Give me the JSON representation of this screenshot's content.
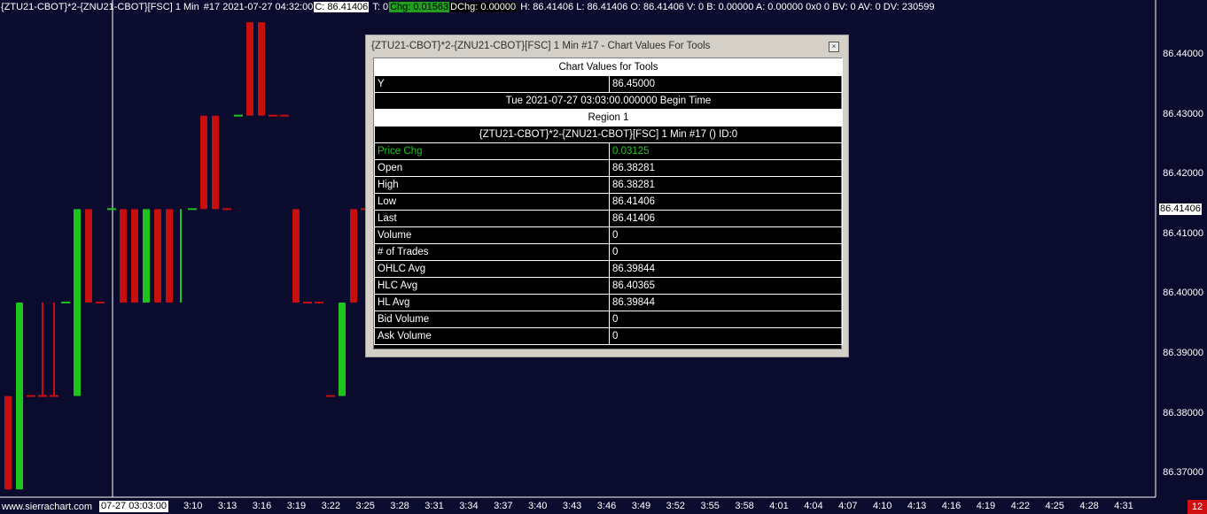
{
  "info_bar": {
    "symbol": "{ZTU21-CBOT}*2-{ZNU21-CBOT}[FSC]  1 Min",
    "bar_info": "#17 2021-07-27 04:32:00",
    "close": "C: 86.41406",
    "trades": "T: 0",
    "chg": "Chg: 0.01563",
    "dchg": "DChg: 0.00000",
    "rest": "H: 86.41406 L: 86.41406 O: 86.41406 V: 0 B: 0.00000 A: 0.00000 0x0 0 BV: 0 AV: 0 DV: 230599"
  },
  "tool_window": {
    "title": "{ZTU21-CBOT}*2-{ZNU21-CBOT}[FSC]  1 Min   #17 - Chart Values For Tools",
    "close_icon": "close-icon",
    "header": "Chart Values for Tools",
    "y_label": "Y",
    "y_value": "86.45000",
    "begin_time": "Tue 2021-07-27  03:03:00.000000 Begin Time",
    "region": "Region 1",
    "study_line": "{ZTU21-CBOT}*2-{ZNU21-CBOT}[FSC]  1 Min   #17 ()   ID:0",
    "rows": [
      {
        "name": "Price Chg",
        "value": "0.03125",
        "green": true
      },
      {
        "name": "Open",
        "value": "86.38281"
      },
      {
        "name": "High",
        "value": "86.38281"
      },
      {
        "name": "Low",
        "value": "86.41406"
      },
      {
        "name": "Last",
        "value": "86.41406"
      },
      {
        "name": "Volume",
        "value": "0"
      },
      {
        "name": "# of Trades",
        "value": "0"
      },
      {
        "name": "OHLC Avg",
        "value": "86.39844"
      },
      {
        "name": "HLC Avg",
        "value": "86.40365"
      },
      {
        "name": "HL Avg",
        "value": "86.39844"
      },
      {
        "name": "Bid Volume",
        "value": "0"
      },
      {
        "name": "Ask Volume",
        "value": "0"
      }
    ]
  },
  "price_axis": {
    "labels": [
      "86.44000",
      "86.43000",
      "86.42000",
      "86.41000",
      "86.40000",
      "86.39000",
      "86.38000",
      "86.37000"
    ],
    "last_price": "86.41406"
  },
  "time_axis": {
    "cursor_time": "07-27  03:03:00",
    "labels": [
      "3:10",
      "3:13",
      "3:16",
      "3:19",
      "3:22",
      "3:25",
      "3:28",
      "3:31",
      "3:34",
      "3:37",
      "3:40",
      "3:43",
      "3:46",
      "3:49",
      "3:52",
      "3:55",
      "3:58",
      "4:01",
      "4:04",
      "4:07",
      "4:10",
      "4:13",
      "4:16",
      "4:19",
      "4:22",
      "4:25",
      "4:28",
      "4:31"
    ]
  },
  "watermark": "www.sierrachart.com",
  "badge": "12",
  "colors": {
    "background": "#0b0b2e",
    "up": "#1ec41e",
    "down": "#c80f0f"
  },
  "chart_data": {
    "type": "candlestick",
    "ylim": [
      86.365,
      86.448
    ],
    "bars": [
      {
        "o": 86.38281,
        "c": 86.36719,
        "dir": "down"
      },
      {
        "o": 86.36719,
        "c": 86.39844,
        "dir": "up"
      },
      {
        "o": 86.38281,
        "c": 86.38281,
        "dir": "flat"
      },
      {
        "o": 86.38281,
        "c": 86.38281,
        "dir": "flat",
        "h": 86.39844
      },
      {
        "o": 86.38281,
        "c": 86.38281,
        "dir": "flat",
        "h": 86.39844
      },
      {
        "o": 86.39844,
        "c": 86.39844,
        "dir": "flat-up"
      },
      {
        "o": 86.38281,
        "c": 86.41406,
        "dir": "up"
      },
      {
        "o": 86.41406,
        "c": 86.39844,
        "dir": "down"
      },
      {
        "o": 86.39844,
        "c": 86.39844,
        "dir": "flat"
      },
      {
        "o": 86.41406,
        "c": 86.41406,
        "dir": "flat-up"
      },
      {
        "o": 86.41406,
        "c": 86.39844,
        "dir": "down"
      },
      {
        "o": 86.41406,
        "c": 86.39844,
        "dir": "down"
      },
      {
        "o": 86.39844,
        "c": 86.41406,
        "dir": "up"
      },
      {
        "o": 86.41406,
        "c": 86.39844,
        "dir": "down"
      },
      {
        "o": 86.41406,
        "c": 86.39844,
        "dir": "down"
      },
      {
        "o": 86.39844,
        "c": 86.41406,
        "dir": "up-line"
      },
      {
        "o": 86.41406,
        "c": 86.41406,
        "dir": "flat-up"
      },
      {
        "o": 86.42969,
        "c": 86.41406,
        "dir": "down"
      },
      {
        "o": 86.42969,
        "c": 86.41406,
        "dir": "down"
      },
      {
        "o": 86.41406,
        "c": 86.41406,
        "dir": "flat"
      },
      {
        "o": 86.42969,
        "c": 86.42969,
        "dir": "flat-up"
      },
      {
        "o": 86.44531,
        "c": 86.42969,
        "dir": "down"
      },
      {
        "o": 86.44531,
        "c": 86.42969,
        "dir": "down"
      },
      {
        "o": 86.42969,
        "c": 86.42969,
        "dir": "flat"
      },
      {
        "o": 86.42969,
        "c": 86.42969,
        "dir": "flat"
      },
      {
        "o": 86.41406,
        "c": 86.39844,
        "dir": "down"
      },
      {
        "o": 86.39844,
        "c": 86.39844,
        "dir": "flat"
      },
      {
        "o": 86.39844,
        "c": 86.39844,
        "dir": "flat"
      },
      {
        "o": 86.38281,
        "c": 86.38281,
        "dir": "flat"
      },
      {
        "o": 86.38281,
        "c": 86.39844,
        "dir": "up"
      },
      {
        "o": 86.41406,
        "c": 86.39844,
        "dir": "down"
      },
      {
        "o": 86.41406,
        "c": 86.41406,
        "dir": "flat"
      }
    ]
  }
}
